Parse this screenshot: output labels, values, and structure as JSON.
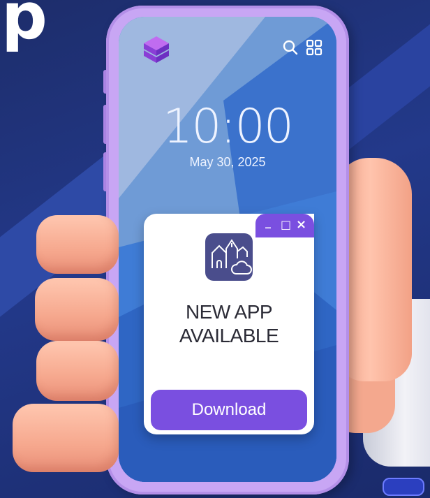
{
  "corner": {
    "letter": "p"
  },
  "lock_screen": {
    "time": "10:00",
    "date": "May 30, 2025",
    "icons": [
      "app-logo-icon",
      "search-icon",
      "grid-icon"
    ]
  },
  "notification": {
    "title_line1": "NEW APP",
    "title_line2": "AVAILABLE",
    "button_label": "Download",
    "controls": {
      "minimize": "_",
      "maximize": "□",
      "close": "×"
    },
    "app_icon": "church-cloud-icon"
  },
  "colors": {
    "background": "#1d2d6b",
    "phone_frame": "#c8a6f4",
    "accent": "#7a4fe0",
    "screen_blue": "#4a86d8",
    "app_icon_bg": "#4a4d8c"
  }
}
